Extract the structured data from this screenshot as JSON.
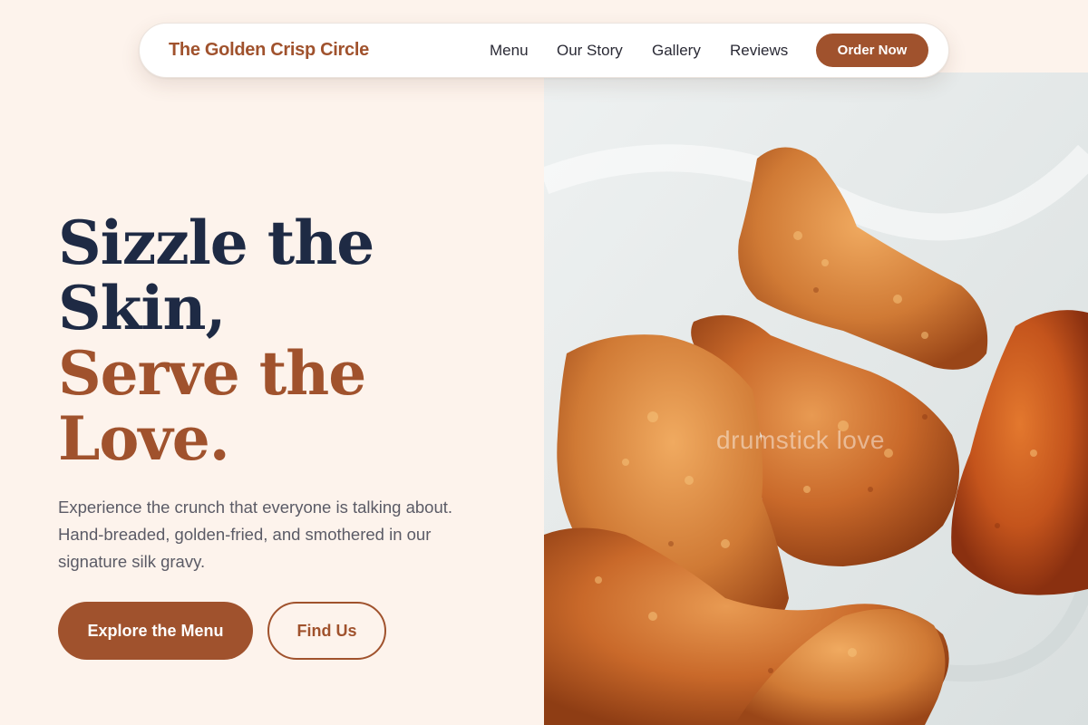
{
  "nav": {
    "brand": "The Golden Crisp Circle",
    "links": [
      "Menu",
      "Our Story",
      "Gallery",
      "Reviews"
    ],
    "cta": "Order Now"
  },
  "hero": {
    "headline_lines": [
      "Sizzle the",
      "Skin,",
      "Serve the",
      "Love."
    ],
    "subtext": "Experience the crunch that everyone is talking about. Hand-breaded, golden-fried, and smothered in our signature silk gravy.",
    "primary_button": "Explore the Menu",
    "secondary_button": "Find Us",
    "image_watermark": "drumstick love"
  },
  "colors": {
    "accent": "#a0522d",
    "headline_dark": "#1e2a44",
    "page_background": "#fdf3ec"
  }
}
